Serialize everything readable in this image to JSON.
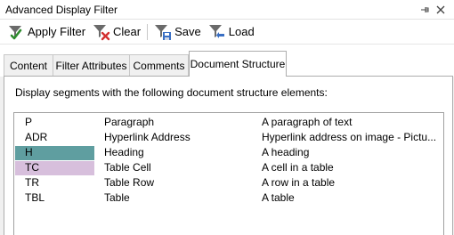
{
  "window": {
    "title": "Advanced Display Filter",
    "pin_icon": "pin-icon",
    "close_icon": "close-icon"
  },
  "toolbar": {
    "apply_label": "Apply Filter",
    "clear_label": "Clear",
    "save_label": "Save",
    "load_label": "Load",
    "colors": {
      "funnel": "#5c5c5c",
      "check": "#2e8b2e",
      "clear_x": "#d32f2f",
      "save_blue": "#3a6fc4"
    }
  },
  "tabs": [
    {
      "label": "Content"
    },
    {
      "label": "Filter Attributes"
    },
    {
      "label": "Comments"
    },
    {
      "label": "Document Structure",
      "active": true
    }
  ],
  "panel": {
    "description": "Display segments with the following document structure elements:"
  },
  "list": {
    "rows": [
      {
        "code": "P",
        "name": "Paragraph",
        "description": "A paragraph of text",
        "highlight": ""
      },
      {
        "code": "ADR",
        "name": "Hyperlink Address",
        "description": "Hyperlink address on image - Pictu...",
        "highlight": ""
      },
      {
        "code": "H",
        "name": "Heading",
        "description": "A heading",
        "highlight": "#5f9ea0"
      },
      {
        "code": "TC",
        "name": "Table Cell",
        "description": "A cell in a table",
        "highlight": "#d7bfdc"
      },
      {
        "code": "TR",
        "name": "Table Row",
        "description": "A row in a table",
        "highlight": ""
      },
      {
        "code": "TBL",
        "name": "Table",
        "description": "A table",
        "highlight": ""
      }
    ]
  }
}
